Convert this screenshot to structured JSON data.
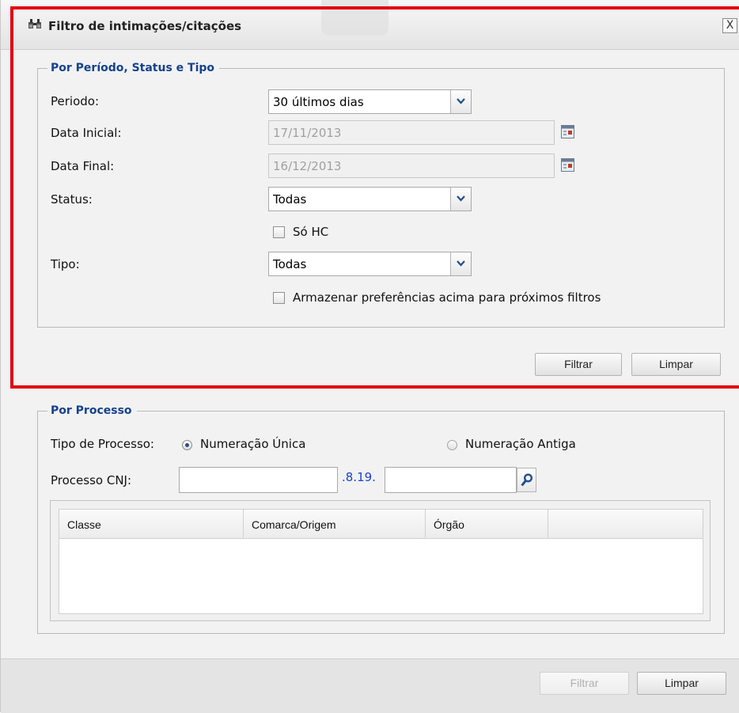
{
  "dialog": {
    "title": "Filtro de intimações/citações",
    "close_label": "X"
  },
  "section_period": {
    "legend": "Por Período, Status e Tipo",
    "periodo_label": "Periodo:",
    "periodo_value": "30 últimos dias",
    "data_inicial_label": "Data Inicial:",
    "data_inicial_value": "17/11/2013",
    "data_final_label": "Data Final:",
    "data_final_value": "16/12/2013",
    "status_label": "Status:",
    "status_value": "Todas",
    "so_hc_label": "Só HC",
    "tipo_label": "Tipo:",
    "tipo_value": "Todas",
    "armazenar_label": "Armazenar preferências acima para próximos filtros",
    "filtrar_label": "Filtrar",
    "limpar_label": "Limpar"
  },
  "section_processo": {
    "legend": "Por Processo",
    "tipo_processo_label": "Tipo de Processo:",
    "radio_unica_label": "Numeração Única",
    "radio_antiga_label": "Numeração Antiga",
    "processo_cnj_label": "Processo CNJ:",
    "cnj_infix": ".8.19.",
    "cnj_part1_value": "",
    "cnj_part2_value": "",
    "grid_columns": [
      "Classe",
      "Comarca/Origem",
      "Órgão",
      ""
    ]
  },
  "footer": {
    "filtrar_label": "Filtrar",
    "limpar_label": "Limpar"
  },
  "colors": {
    "legend_blue": "#15428b",
    "highlight_red": "#e3000f",
    "cnj_infix_blue": "#1a3fd6"
  }
}
